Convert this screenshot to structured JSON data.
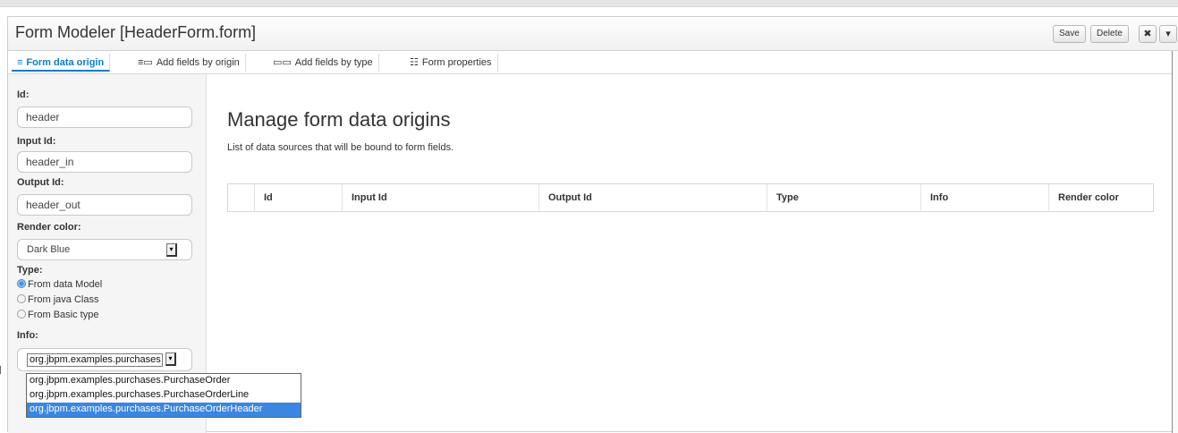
{
  "window": {
    "title": "Form Modeler [HeaderForm.form]",
    "buttons": {
      "save": "Save",
      "delete": "Delete",
      "close": "✖",
      "menu": "▾"
    }
  },
  "tabs": [
    {
      "label": "Form data origin",
      "icon": "database-icon",
      "active": true
    },
    {
      "label": "Add fields by origin",
      "icon": "fields-origin-icon",
      "active": false
    },
    {
      "label": "Add fields by type",
      "icon": "fields-type-icon",
      "active": false
    },
    {
      "label": "Form properties",
      "icon": "form-properties-icon",
      "active": false
    }
  ],
  "sidebar": {
    "id_label": "Id:",
    "id_value": "header",
    "input_id_label": "Input Id:",
    "input_id_value": "header_in",
    "output_id_label": "Output Id:",
    "output_id_value": "header_out",
    "render_color_label": "Render color:",
    "render_color_value": "Dark Blue",
    "type_label": "Type:",
    "type_options": [
      {
        "label": "From data Model",
        "checked": true
      },
      {
        "label": "From java Class",
        "checked": false
      },
      {
        "label": "From Basic type",
        "checked": false
      }
    ],
    "info_label": "Info:",
    "info_value": "org.jbpm.examples.purchases",
    "info_options": [
      {
        "label": "org.jbpm.examples.purchases.PurchaseOrder",
        "selected": false
      },
      {
        "label": "org.jbpm.examples.purchases.PurchaseOrderLine",
        "selected": false
      },
      {
        "label": "org.jbpm.examples.purchases.PurchaseOrderHeader",
        "selected": true
      }
    ]
  },
  "main": {
    "title": "Manage form data origins",
    "subtitle": "List of data sources that will be bound to form fields.",
    "columns": [
      "",
      "Id",
      "Input Id",
      "Output Id",
      "Type",
      "Info",
      "Render color"
    ]
  },
  "colors": {
    "accent": "#0a7ecb",
    "selection": "#3b86e0",
    "sidebar_bg": "#f5f5f5"
  }
}
